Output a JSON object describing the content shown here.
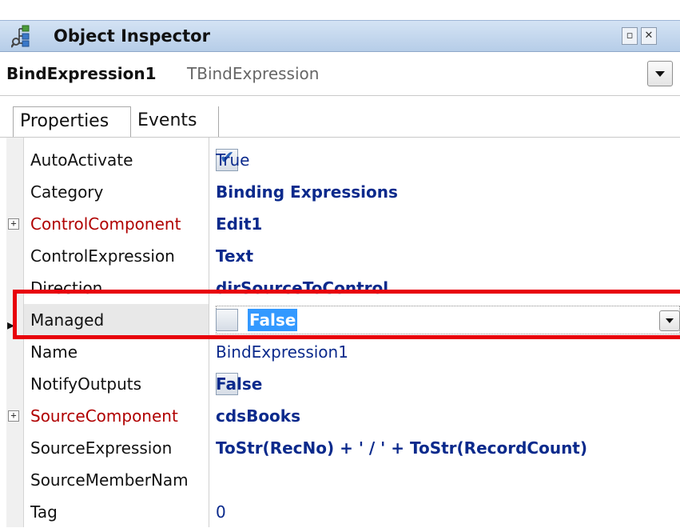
{
  "window": {
    "title": "Object Inspector",
    "pin_glyph": "▫",
    "close_glyph": "✕"
  },
  "object_selector": {
    "name": "BindExpression1",
    "class": "TBindExpression"
  },
  "tabs": [
    {
      "label": "Properties",
      "active": true
    },
    {
      "label": "Events",
      "active": false
    }
  ],
  "properties": [
    {
      "name": "AutoActivate",
      "value": "True",
      "type": "bool",
      "checked": true
    },
    {
      "name": "Category",
      "value": "Binding Expressions"
    },
    {
      "name": "ControlComponent",
      "value": "Edit1",
      "expandable": true
    },
    {
      "name": "ControlExpression",
      "value": "Text"
    },
    {
      "name": "Direction",
      "value": "dirSourceToControl"
    },
    {
      "name": "Managed",
      "value": "False",
      "type": "bool",
      "checked": false,
      "selected": true
    },
    {
      "name": "Name",
      "value": "BindExpression1"
    },
    {
      "name": "NotifyOutputs",
      "value": "False",
      "type": "bool",
      "checked": false
    },
    {
      "name": "SourceComponent",
      "value": "cdsBooks",
      "expandable": true
    },
    {
      "name": "SourceExpression",
      "value": "ToStr(RecNo) + ' / ' + ToStr(RecordCount)"
    },
    {
      "name": "SourceMemberNam",
      "value": ""
    },
    {
      "name": "Tag",
      "value": "0"
    }
  ],
  "pointer_glyph": "▸",
  "colors": {
    "highlight_border": "#e8000b",
    "selection": "#3399ff",
    "value_text": "#0b2a8c",
    "component_ref": "#b00000"
  }
}
